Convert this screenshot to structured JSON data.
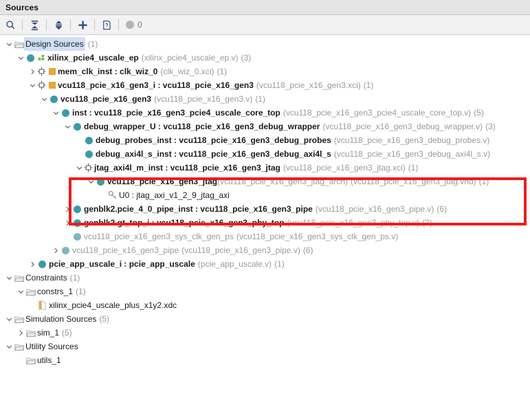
{
  "window": {
    "title": "Sources"
  },
  "toolbar": {
    "buttons": [
      {
        "name": "search-icon",
        "tooltip": "Search"
      },
      {
        "name": "collapse-all-icon",
        "tooltip": "Collapse All"
      },
      {
        "name": "expand-collapse-icon",
        "tooltip": "Expand/Collapse"
      },
      {
        "name": "add-sources-icon",
        "tooltip": "Add Sources"
      },
      {
        "name": "help-icon",
        "tooltip": "Help"
      }
    ],
    "counter": {
      "value": "0",
      "icon": "status-circle-icon"
    }
  },
  "colors": {
    "accent_teal": "#3d9aa8",
    "accent_orange": "#f0a830",
    "highlight_red": "#ee1c1c",
    "selection_blue": "#cfe0f5",
    "toolbar_icon": "#2f4f82",
    "muted_text": "#9a9a9a"
  },
  "tree": {
    "rows": [
      {
        "indent": 0,
        "twisty": "down",
        "icon": "folder-icon",
        "label": "Design Sources",
        "count": "(1)",
        "selected": true
      },
      {
        "indent": 1,
        "twisty": "down",
        "icon": "module-circle-icon",
        "icon2": "green-chip-icon",
        "label": "xilinx_pcie4_uscale_ep",
        "bold": true,
        "meta": "(xilinx_pcie4_uscale_ep.v)",
        "count": "(3)"
      },
      {
        "indent": 2,
        "twisty": "right",
        "icon": "ip-chip-icon",
        "icon2": "orange-square-icon",
        "label": "mem_clk_inst : clk_wiz_0",
        "bold": true,
        "meta": "(clk_wiz_0.xci)",
        "count": "(1)"
      },
      {
        "indent": 2,
        "twisty": "down",
        "icon": "ip-chip-icon",
        "icon2": "orange-square-icon",
        "label": "vcu118_pcie_x16_gen3_i : vcu118_pcie_x16_gen3",
        "bold": true,
        "meta": "(vcu118_pcie_x16_gen3.xci)",
        "count": "(1)"
      },
      {
        "indent": 3,
        "twisty": "down",
        "icon": "module-circle-icon",
        "label": "vcu118_pcie_x16_gen3",
        "bold": true,
        "meta": "(vcu118_pcie_x16_gen3.v)",
        "count": "(1)"
      },
      {
        "indent": 4,
        "twisty": "down",
        "icon": "module-circle-icon",
        "label": "inst : vcu118_pcie_x16_gen3_pcie4_uscale_core_top",
        "bold": true,
        "meta": "(vcu118_pcie_x16_gen3_pcie4_uscale_core_top.v)",
        "count": "(5)"
      },
      {
        "indent": 5,
        "twisty": "down",
        "icon": "module-circle-icon",
        "label": "debug_wrapper_U : vcu118_pcie_x16_gen3_debug_wrapper",
        "bold": true,
        "meta": "(vcu118_pcie_x16_gen3_debug_wrapper.v)",
        "count": "(3)"
      },
      {
        "indent": 6,
        "twisty": "none",
        "icon": "module-circle-icon",
        "label": "debug_probes_inst : vcu118_pcie_x16_gen3_debug_probes",
        "bold": true,
        "meta": "(vcu118_pcie_x16_gen3_debug_probes.v)",
        "count": ""
      },
      {
        "indent": 6,
        "twisty": "none",
        "icon": "module-circle-icon",
        "label": "debug_axi4l_s_inst : vcu118_pcie_x16_gen3_debug_axi4l_s",
        "bold": true,
        "meta": "(vcu118_pcie_x16_gen3_debug_axi4l_s.v)",
        "count": ""
      },
      {
        "indent": 6,
        "twisty": "down",
        "icon": "ip-chip-icon",
        "label": "jtag_axi4l_m_inst : vcu118_pcie_x16_gen3_jtag",
        "bold": true,
        "meta": "(vcu118_pcie_x16_gen3_jtag.xci)",
        "count": "(1)"
      },
      {
        "indent": 7,
        "twisty": "down",
        "icon": "module-circle-icon",
        "label": "vcu118_pcie_x16_gen3_jtag",
        "bold": true,
        "meta": "(vcu118_pcie_x16_gen3_jtag_arch)",
        "meta2": "(vcu118_pcie_x16_gen3_jtag.vhd)",
        "count": "(1)",
        "tight": true
      },
      {
        "indent": 8,
        "twisty": "none",
        "icon": "key-icon",
        "label": "U0 : jtag_axi_v1_2_9_jtag_axi",
        "meta": "",
        "count": ""
      },
      {
        "indent": 5,
        "twisty": "right",
        "icon": "module-circle-icon",
        "label": "genblk2.pcie_4_0_pipe_inst : vcu118_pcie_x16_gen3_pipe",
        "bold": true,
        "meta": "(vcu118_pcie_x16_gen3_pipe.v)",
        "count": "(6)"
      },
      {
        "indent": 5,
        "twisty": "right",
        "icon": "module-circle-icon",
        "label": "genblk2.gt_top_i : vcu118_pcie_x16_gen3_phy_top",
        "bold": true,
        "meta": "(vcu118_pcie_x16_gen3_phy_top.v)",
        "count": "(2)"
      },
      {
        "indent": 5,
        "twisty": "none",
        "icon": "module-circle-icon",
        "label": "vcu118_pcie_x16_gen3_sys_clk_gen_ps",
        "dim": true,
        "meta": "(vcu118_pcie_x16_gen3_sys_clk_gen_ps.v)",
        "count": ""
      },
      {
        "indent": 4,
        "twisty": "right",
        "icon": "module-circle-icon",
        "label": "vcu118_pcie_x16_gen3_pipe",
        "dim": true,
        "meta": "(vcu118_pcie_x16_gen3_pipe.v)",
        "count": "(6)"
      },
      {
        "indent": 2,
        "twisty": "right",
        "icon": "module-circle-icon",
        "label": "pcie_app_uscale_i : pcie_app_uscale",
        "bold": true,
        "meta": "(pcie_app_uscale.v)",
        "count": "(1)"
      },
      {
        "indent": 0,
        "twisty": "down",
        "icon": "folder-icon",
        "label": "Constraints",
        "count": "(1)"
      },
      {
        "indent": 1,
        "twisty": "down",
        "icon": "folder-icon",
        "label": "constrs_1",
        "count": "(1)"
      },
      {
        "indent": 2,
        "twisty": "none",
        "icon": "xdc-file-icon",
        "label": "xilinx_pcie4_uscale_plus_x1y2.xdc",
        "count": ""
      },
      {
        "indent": 0,
        "twisty": "down",
        "icon": "folder-icon",
        "label": "Simulation Sources",
        "count": "(5)"
      },
      {
        "indent": 1,
        "twisty": "right",
        "icon": "folder-icon",
        "label": "sim_1",
        "count": "(5)"
      },
      {
        "indent": 0,
        "twisty": "down",
        "icon": "folder-icon",
        "label": "Utility Sources",
        "count": ""
      },
      {
        "indent": 1,
        "twisty": "none",
        "icon": "folder-icon",
        "label": "utils_1",
        "count": ""
      }
    ]
  },
  "annotation": {
    "highlight_box": {
      "label": "jtag-highlight-box",
      "color": "#ee1c1c"
    }
  }
}
